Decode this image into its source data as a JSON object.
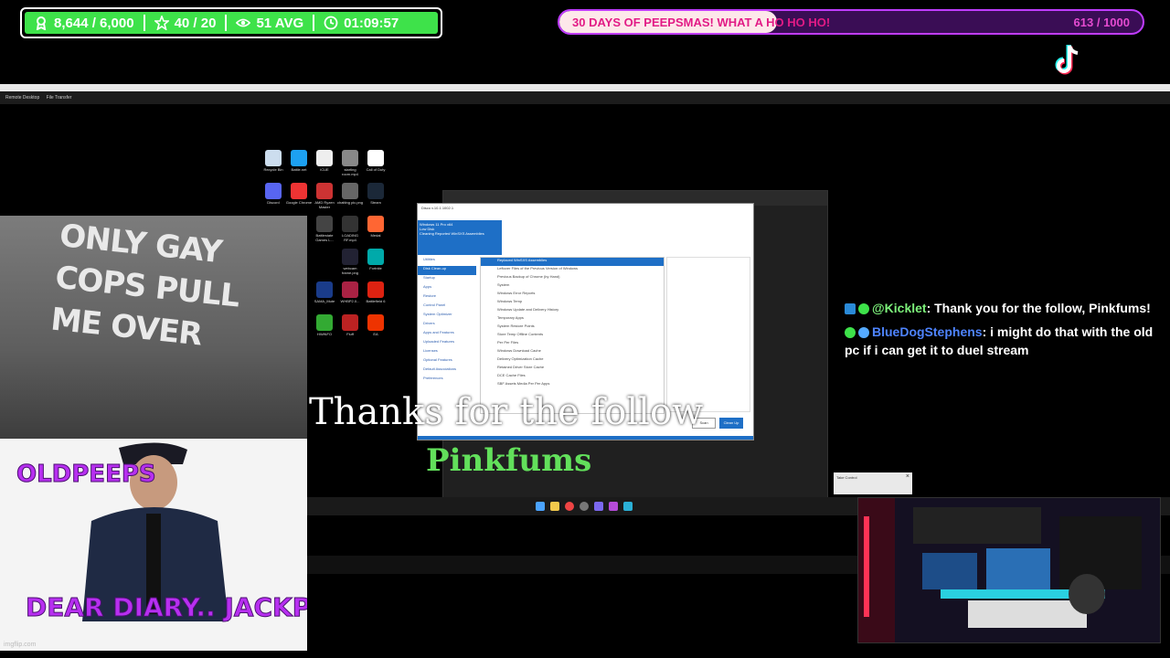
{
  "stats": {
    "xp": "8,644 / 6,000",
    "stars": "40 / 20",
    "viewers": "51 AVG",
    "timer": "01:09:57",
    "accent": "#3ee24a"
  },
  "goal": {
    "label": "30 DAYS OF PEEPSMAS! WHAT A HO HO HO!",
    "count": "613 / 1000",
    "progress": 0.613
  },
  "remote_desktop": {
    "tabs": [
      "Remote Desktop",
      "File Transfer"
    ]
  },
  "desktop_icons": [
    {
      "label": "Recycle Bin"
    },
    {
      "label": "Battle.net"
    },
    {
      "label": "iCUE"
    },
    {
      "label": "starting room.mp4"
    },
    {
      "label": "Call of Duty"
    },
    {
      "label": "Discord"
    },
    {
      "label": "Google Chrome"
    },
    {
      "label": "AMD Ryzen Master"
    },
    {
      "label": "chatting pic.png"
    },
    {
      "label": "Steam"
    },
    {
      "label": "Battlestate Games L..."
    },
    {
      "label": "LOADING RF.mp4"
    },
    {
      "label": "Medal"
    },
    {
      "label": "webcam frame.png"
    },
    {
      "label": "Fortnite"
    },
    {
      "label": "SAMA_Mute"
    },
    {
      "label": "WHBP2.0..."
    },
    {
      "label": "Battlefield 6"
    },
    {
      "label": "HWiNFO"
    },
    {
      "label": "Fluff"
    },
    {
      "label": "EA"
    }
  ],
  "window": {
    "title": "Disco v.10.1.1002.1",
    "header_lines": [
      "Windows 11 Pro x64",
      "Low Disk",
      "Cleaning Reported WinSXS Assemblies"
    ],
    "nav": [
      "Utilities",
      "Disk Clean-up",
      "Startup",
      "Apps",
      "Restore",
      "Control Panel",
      "System Optimizer",
      "Drivers",
      "Apps and Features",
      "Uploaded Features",
      "Licenses",
      "Optional Features",
      "Default Associations",
      "Preferences"
    ],
    "list": [
      "Replaced WinSXS Assemblies",
      "Leftover Files of the Previous Version of Windows",
      "Previous Backup of Chrome (by Hand)",
      "System",
      "Windows Error Reports",
      "Windows Temp",
      "Windows Update and Delivery History",
      "Temporary Apps",
      "System Restore Points",
      "Store Temp Offline Contents",
      "Per Per Files",
      "Windows Download Cache",
      "Delivery Optimization Cache",
      "Retained Driver Store Cache",
      "DCE Cache Files",
      "SBF Assets Media Per Per Apps"
    ],
    "buttons": {
      "cancel": "Scan",
      "primary": "Clean Up"
    },
    "status": "4 items   1 item selected  1.02 MB"
  },
  "alert": {
    "title": "Thanks for the follow",
    "name": "Pinkfums"
  },
  "chat": [
    {
      "user": "@Kicklet",
      "message": ": Thank you for the follow, Pinkfums!"
    },
    {
      "user": "BlueDogStephens",
      "message": ": i might do that with the old pc if i can get it to duel stream"
    }
  ],
  "cam_top": {
    "sticker": "ONLY GAY COPS PULL ME OVER"
  },
  "meme": {
    "top_text": "OLDPEEPS",
    "bottom_text": "DEAR DIARY.. JACKPOT",
    "watermark": "imgflip.com"
  },
  "take_control": {
    "title": "Take Control"
  }
}
